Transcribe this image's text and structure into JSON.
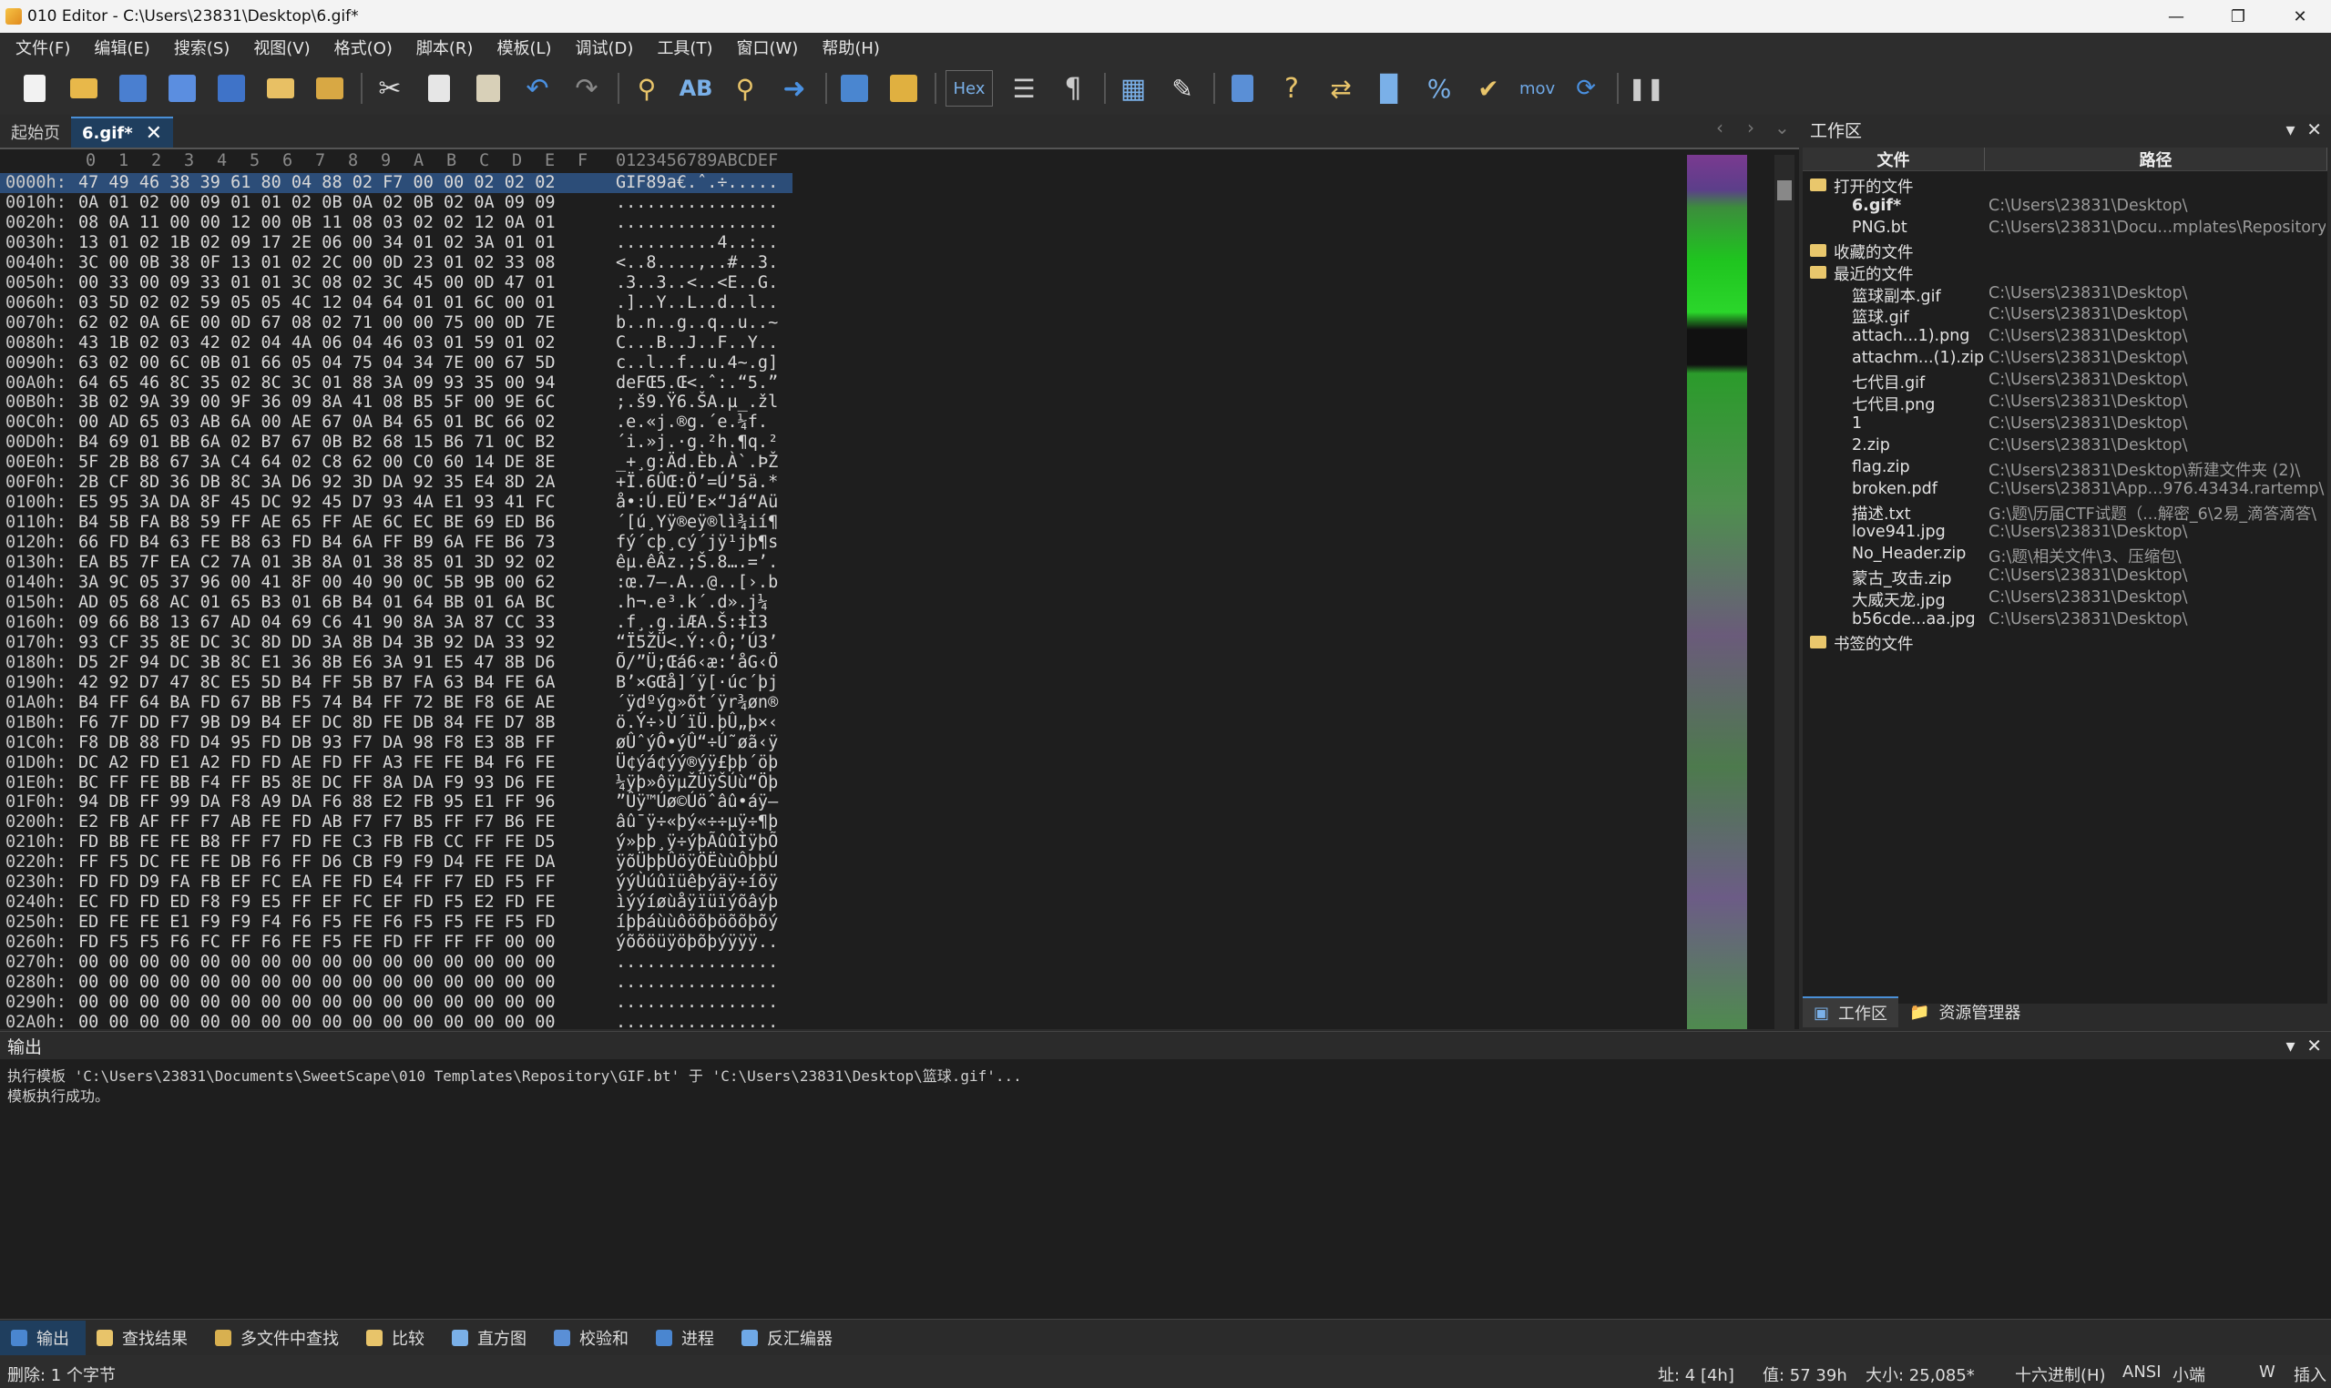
{
  "window": {
    "title": "010 Editor - C:\\Users\\23831\\Desktop\\6.gif*"
  },
  "menu": [
    "文件(F)",
    "编辑(E)",
    "搜索(S)",
    "视图(V)",
    "格式(O)",
    "脚本(R)",
    "模板(L)",
    "调试(D)",
    "工具(T)",
    "窗口(W)",
    "帮助(H)"
  ],
  "toolbar": {
    "hex_label": "Hex",
    "mov_label": "mov"
  },
  "tabs": {
    "start": "起始页",
    "file": "6.gif*"
  },
  "hex": {
    "col_headers": [
      "0",
      "1",
      "2",
      "3",
      "4",
      "5",
      "6",
      "7",
      "8",
      "9",
      "A",
      "B",
      "C",
      "D",
      "E",
      "F"
    ],
    "ascii_header": "0123456789ABCDEF",
    "rows": [
      {
        "addr": "0000h:",
        "bytes": "47 49 46 38 39 61 80 04 88 02 F7 00 00 02 02 02",
        "ascii": "GIF89a€.ˆ.÷....."
      },
      {
        "addr": "0010h:",
        "bytes": "0A 01 02 00 09 01 01 02 0B 0A 02 0B 02 0A 09 09",
        "ascii": "................"
      },
      {
        "addr": "0020h:",
        "bytes": "08 0A 11 00 00 12 00 0B 11 08 03 02 02 12 0A 01",
        "ascii": "................"
      },
      {
        "addr": "0030h:",
        "bytes": "13 01 02 1B 02 09 17 2E 06 00 34 01 02 3A 01 01",
        "ascii": "..........4..:.."
      },
      {
        "addr": "0040h:",
        "bytes": "3C 00 0B 38 0F 13 01 02 2C 00 0D 23 01 02 33 08",
        "ascii": "<..8....,..#..3."
      },
      {
        "addr": "0050h:",
        "bytes": "00 33 00 09 33 01 01 3C 08 02 3C 45 00 0D 47 01",
        "ascii": ".3..3..<..<E..G."
      },
      {
        "addr": "0060h:",
        "bytes": "03 5D 02 02 59 05 05 4C 12 04 64 01 01 6C 00 01",
        "ascii": ".]..Y..L..d..l.."
      },
      {
        "addr": "0070h:",
        "bytes": "62 02 0A 6E 00 0D 67 08 02 71 00 00 75 00 0D 7E",
        "ascii": "b..n..g..q..u..~"
      },
      {
        "addr": "0080h:",
        "bytes": "43 1B 02 03 42 02 04 4A 06 04 46 03 01 59 01 02",
        "ascii": "C...B..J..F..Y.."
      },
      {
        "addr": "0090h:",
        "bytes": "63 02 00 6C 0B 01 66 05 04 75 04 34 7E 00 67 5D",
        "ascii": "c..l..f..u.4~.g]"
      },
      {
        "addr": "00A0h:",
        "bytes": "64 65 46 8C 35 02 8C 3C 01 88 3A 09 93 35 00 94",
        "ascii": "deFŒ5.Œ<.ˆ:.“5.”"
      },
      {
        "addr": "00B0h:",
        "bytes": "3B 02 9A 39 00 9F 36 09 8A 41 08 B5 5F 00 9E 6C",
        "ascii": ";.š9.Ÿ6.ŠA.µ_.žl"
      },
      {
        "addr": "00C0h:",
        "bytes": "00 AD 65 03 AB 6A 00 AE 67 0A B4 65 01 BC 66 02",
        "ascii": ".­e.«j.®g.´e.¼f."
      },
      {
        "addr": "00D0h:",
        "bytes": "B4 69 01 BB 6A 02 B7 67 0B B2 68 15 B6 71 0C B2",
        "ascii": "´i.»j.·g.²h.¶q.²"
      },
      {
        "addr": "00E0h:",
        "bytes": "5F 2B B8 67 3A C4 64 02 C8 62 00 C0 60 14 DE 8E",
        "ascii": "_+¸g:Äd.Èb.À`.ÞŽ"
      },
      {
        "addr": "00F0h:",
        "bytes": "2B CF 8D 36 DB 8C 3A D6 92 3D DA 92 35 E4 8D 2A",
        "ascii": "+Ï.6ÛŒ:Ö’=Ú’5ä.*"
      },
      {
        "addr": "0100h:",
        "bytes": "E5 95 3A DA 8F 45 DC 92 45 D7 93 4A E1 93 41 FC",
        "ascii": "å•:Ú.EÜ’E×“Já“Aü"
      },
      {
        "addr": "0110h:",
        "bytes": "B4 5B FA B8 59 FF AE 65 FF AE 6C EC BE 69 ED B6",
        "ascii": "´[ú¸Yÿ®eÿ®lì¾ií¶"
      },
      {
        "addr": "0120h:",
        "bytes": "66 FD B4 63 FE B8 63 FD B4 6A FF B9 6A FE B6 73",
        "ascii": "fý´cþ¸cý´jÿ¹jþ¶s"
      },
      {
        "addr": "0130h:",
        "bytes": "EA B5 7F EA C2 7A 01 3B 8A 01 38 85 01 3D 92 02",
        "ascii": "êµ.êÂz.;Š.8….=’."
      },
      {
        "addr": "0140h:",
        "bytes": "3A 9C 05 37 96 00 41 8F 00 40 90 0C 5B 9B 00 62",
        "ascii": ":œ.7–.A..@..[›.b"
      },
      {
        "addr": "0150h:",
        "bytes": "AD 05 68 AC 01 65 B3 01 6B B4 01 64 BB 01 6A BC",
        "ascii": "­.h¬.e³.k´.d».j¼"
      },
      {
        "addr": "0160h:",
        "bytes": "09 66 B8 13 67 AD 04 69 C6 41 90 8A 3A 87 CC 33",
        "ascii": ".f¸.g­.iÆA.Š:‡Ì3"
      },
      {
        "addr": "0170h:",
        "bytes": "93 CF 35 8E DC 3C 8D DD 3A 8B D4 3B 92 DA 33 92",
        "ascii": "“Ï5ŽÜ<.Ý:‹Ô;’Ú3’"
      },
      {
        "addr": "0180h:",
        "bytes": "D5 2F 94 DC 3B 8C E1 36 8B E6 3A 91 E5 47 8B D6",
        "ascii": "Õ/”Ü;Œá6‹æ:‘åG‹Ö"
      },
      {
        "addr": "0190h:",
        "bytes": "42 92 D7 47 8C E5 5D B4 FF 5B B7 FA 63 B4 FE 6A",
        "ascii": "B’×GŒå]´ÿ[·úc´þj"
      },
      {
        "addr": "01A0h:",
        "bytes": "B4 FF 64 BA FD 67 BB F5 74 B4 FF 72 BE F8 6E AE",
        "ascii": "´ÿdºýg»õt´ÿr¾øn®"
      },
      {
        "addr": "01B0h:",
        "bytes": "F6 7F DD F7 9B D9 B4 EF DC 8D FE DB 84 FE D7 8B",
        "ascii": "ö.Ý÷›Ù´ïÜ.þÛ„þ×‹"
      },
      {
        "addr": "01C0h:",
        "bytes": "F8 DB 88 FD D4 95 FD DB 93 F7 DA 98 F8 E3 8B FF",
        "ascii": "øÛˆýÔ•ýÛ“÷Ú˜øã‹ÿ"
      },
      {
        "addr": "01D0h:",
        "bytes": "DC A2 FD E1 A2 FD FD AE FD FF A3 FE FE B4 F6 FE",
        "ascii": "Ü¢ýá¢ýý®ýÿ£þþ´öþ"
      },
      {
        "addr": "01E0h:",
        "bytes": "BC FF FE BB F4 FF B5 8E DC FF 8A DA F9 93 D6 FE",
        "ascii": "¼ÿþ»ôÿµŽÜÿŠÚù“Öþ"
      },
      {
        "addr": "01F0h:",
        "bytes": "94 DB FF 99 DA F8 A9 DA F6 88 E2 FB 95 E1 FF 96",
        "ascii": "”Ûÿ™Úø©Úöˆâû•áÿ–"
      },
      {
        "addr": "0200h:",
        "bytes": "E2 FB AF FF F7 AB FE FD AB F7 F7 B5 FF F7 B6 FE",
        "ascii": "âû¯ÿ÷«þý«÷÷µÿ÷¶þ"
      },
      {
        "addr": "0210h:",
        "bytes": "FD BB FE FE B8 FF F7 FD FE C3 FB FB CC FF FE D5",
        "ascii": "ý»þþ¸ÿ÷ýþÃûûÌÿþÕ"
      },
      {
        "addr": "0220h:",
        "bytes": "FF F5 DC FE FE DB F6 FF D6 CB F9 F9 D4 FE FE DA",
        "ascii": "ÿõÜþþÛöÿÖËùùÔþþÚ"
      },
      {
        "addr": "0230h:",
        "bytes": "FD FD D9 FA FB EF FC EA FE FD E4 FF F7 ED F5 FF",
        "ascii": "ýýÙúûïüêþýäÿ÷íõÿ"
      },
      {
        "addr": "0240h:",
        "bytes": "EC FD FD ED F8 F9 E5 FF EF FC EF FD F5 E2 FD FE",
        "ascii": "ìýýíøùåÿïüïýõâýþ"
      },
      {
        "addr": "0250h:",
        "bytes": "ED FE FE E1 F9 F9 F4 F6 F5 FE F6 F5 F5 FE F5 FD",
        "ascii": "íþþáùùôöõþöõõþõý"
      },
      {
        "addr": "0260h:",
        "bytes": "FD F5 F5 F6 FC FF F6 FE F5 FE FD FF FF FF 00 00",
        "ascii": "ýõõöüÿöþõþýÿÿÿ.."
      },
      {
        "addr": "0270h:",
        "bytes": "00 00 00 00 00 00 00 00 00 00 00 00 00 00 00 00",
        "ascii": "................"
      },
      {
        "addr": "0280h:",
        "bytes": "00 00 00 00 00 00 00 00 00 00 00 00 00 00 00 00",
        "ascii": "................"
      },
      {
        "addr": "0290h:",
        "bytes": "00 00 00 00 00 00 00 00 00 00 00 00 00 00 00 00",
        "ascii": "................"
      },
      {
        "addr": "02A0h:",
        "bytes": "00 00 00 00 00 00 00 00 00 00 00 00 00 00 00 00",
        "ascii": "................"
      }
    ]
  },
  "workspace": {
    "title": "工作区",
    "col_file": "文件",
    "col_path": "路径",
    "groups": {
      "open": "打开的文件",
      "favorites": "收藏的文件",
      "recent": "最近的文件",
      "bookmarks": "书签的文件"
    },
    "open_files": [
      {
        "name": "6.gif*",
        "path": "C:\\Users\\23831\\Desktop\\"
      },
      {
        "name": "PNG.bt",
        "path": "C:\\Users\\23831\\Docu...mplates\\Repository\\"
      }
    ],
    "recent_files": [
      {
        "name": "篮球副本.gif",
        "path": "C:\\Users\\23831\\Desktop\\"
      },
      {
        "name": "篮球.gif",
        "path": "C:\\Users\\23831\\Desktop\\"
      },
      {
        "name": "attach...1).png",
        "path": "C:\\Users\\23831\\Desktop\\"
      },
      {
        "name": "attachm...(1).zip",
        "path": "C:\\Users\\23831\\Desktop\\"
      },
      {
        "name": "七代目.gif",
        "path": "C:\\Users\\23831\\Desktop\\"
      },
      {
        "name": "七代目.png",
        "path": "C:\\Users\\23831\\Desktop\\"
      },
      {
        "name": "1",
        "path": "C:\\Users\\23831\\Desktop\\"
      },
      {
        "name": "2.zip",
        "path": "C:\\Users\\23831\\Desktop\\"
      },
      {
        "name": "flag.zip",
        "path": "C:\\Users\\23831\\Desktop\\新建文件夹 (2)\\"
      },
      {
        "name": "broken.pdf",
        "path": "C:\\Users\\23831\\App...976.43434.rartemp\\"
      },
      {
        "name": "描述.txt",
        "path": "G:\\题\\历届CTF试题（...解密_6\\2易_滴答滴答\\"
      },
      {
        "name": "love941.jpg",
        "path": "C:\\Users\\23831\\Desktop\\"
      },
      {
        "name": "No_Header.zip",
        "path": "G:\\题\\相关文件\\3、压缩包\\"
      },
      {
        "name": "蒙古_攻击.zip",
        "path": "C:\\Users\\23831\\Desktop\\"
      },
      {
        "name": "大威天龙.jpg",
        "path": "C:\\Users\\23831\\Desktop\\"
      },
      {
        "name": "b56cde...aa.jpg",
        "path": "C:\\Users\\23831\\Desktop\\"
      }
    ],
    "tab_workspace": "工作区",
    "tab_explorer": "资源管理器"
  },
  "output": {
    "title": "输出",
    "lines": [
      "执行模板 'C:\\Users\\23831\\Documents\\SweetScape\\010 Templates\\Repository\\GIF.bt' 于 'C:\\Users\\23831\\Desktop\\篮球.gif'...",
      "模板执行成功。"
    ]
  },
  "output_tabs": [
    "输出",
    "查找结果",
    "多文件中查找",
    "比较",
    "直方图",
    "校验和",
    "进程",
    "反汇编器"
  ],
  "status": {
    "left": "删除: 1 个字节",
    "addr": "址: 4 [4h]",
    "value": "值: 57 39h",
    "size": "大小: 25,085*",
    "mode": "十六进制(H)",
    "encoding": "ANSI",
    "endian": "小端",
    "w": "W",
    "insert": "插入"
  }
}
